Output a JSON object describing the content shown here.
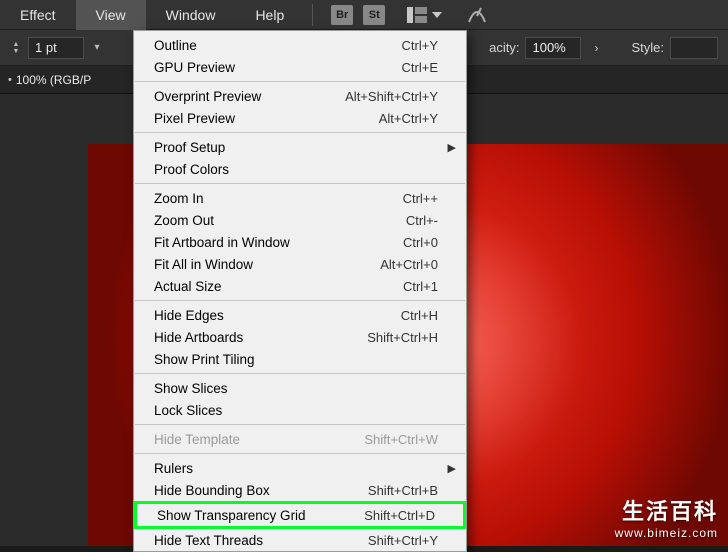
{
  "menubar": {
    "items": [
      {
        "label": "Effect"
      },
      {
        "label": "View"
      },
      {
        "label": "Window"
      },
      {
        "label": "Help"
      }
    ],
    "icons": {
      "bridge": "Br",
      "stock": "St"
    }
  },
  "optbar": {
    "stroke_value": "1 pt",
    "opacity_label": "acity:",
    "opacity_value": "100%",
    "style_label": "Style:"
  },
  "tabbar": {
    "doc_label": "100% (RGB/P"
  },
  "view_menu": {
    "groups": [
      [
        {
          "label": "Outline",
          "shortcut": "Ctrl+Y"
        },
        {
          "label": "GPU Preview",
          "shortcut": "Ctrl+E"
        }
      ],
      [
        {
          "label": "Overprint Preview",
          "shortcut": "Alt+Shift+Ctrl+Y"
        },
        {
          "label": "Pixel Preview",
          "shortcut": "Alt+Ctrl+Y"
        }
      ],
      [
        {
          "label": "Proof Setup",
          "submenu": true
        },
        {
          "label": "Proof Colors"
        }
      ],
      [
        {
          "label": "Zoom In",
          "shortcut": "Ctrl++"
        },
        {
          "label": "Zoom Out",
          "shortcut": "Ctrl+-"
        },
        {
          "label": "Fit Artboard in Window",
          "shortcut": "Ctrl+0"
        },
        {
          "label": "Fit All in Window",
          "shortcut": "Alt+Ctrl+0"
        },
        {
          "label": "Actual Size",
          "shortcut": "Ctrl+1"
        }
      ],
      [
        {
          "label": "Hide Edges",
          "shortcut": "Ctrl+H"
        },
        {
          "label": "Hide Artboards",
          "shortcut": "Shift+Ctrl+H"
        },
        {
          "label": "Show Print Tiling"
        }
      ],
      [
        {
          "label": "Show Slices"
        },
        {
          "label": "Lock Slices"
        }
      ],
      [
        {
          "label": "Hide Template",
          "shortcut": "Shift+Ctrl+W",
          "disabled": true
        }
      ],
      [
        {
          "label": "Rulers",
          "submenu": true
        },
        {
          "label": "Hide Bounding Box",
          "shortcut": "Shift+Ctrl+B"
        },
        {
          "label": "Show Transparency Grid",
          "shortcut": "Shift+Ctrl+D",
          "highlight": true
        },
        {
          "label": "Hide Text Threads",
          "shortcut": "Shift+Ctrl+Y"
        }
      ]
    ]
  },
  "watermark": {
    "line1": "生活百科",
    "line2": "www.bimeiz.com"
  }
}
